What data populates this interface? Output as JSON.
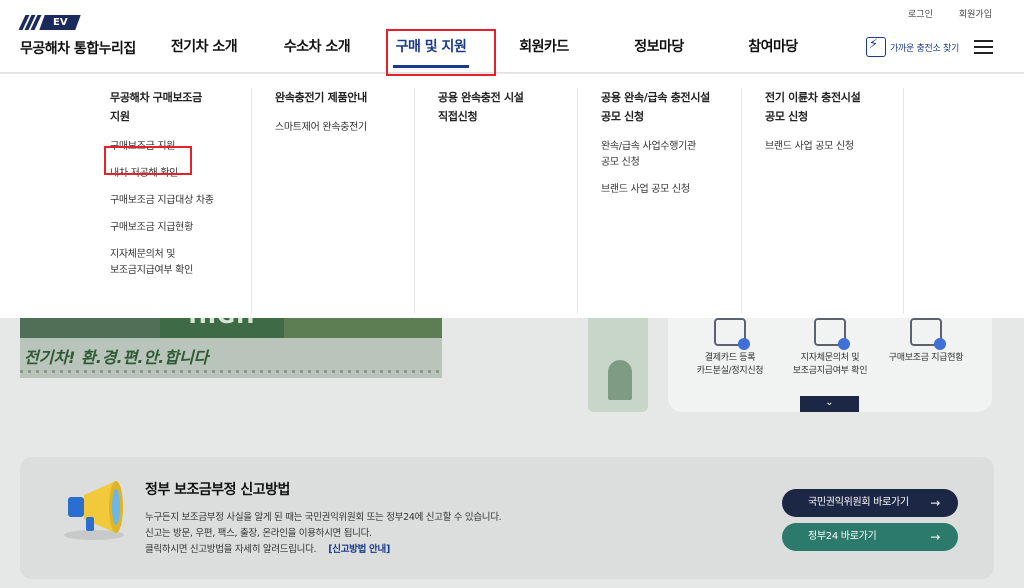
{
  "header": {
    "logo_badge": "EV",
    "logo_text": "무공해차 통합누리집",
    "util_links": [
      "로그인",
      "회원가입"
    ],
    "nav": [
      {
        "label": "전기차 소개"
      },
      {
        "label": "수소차 소개"
      },
      {
        "label": "구매 및 지원",
        "active": true
      },
      {
        "label": "회원카드"
      },
      {
        "label": "정보마당"
      },
      {
        "label": "참여마당"
      }
    ],
    "charger_find_label": "가까운 충전소 찾기",
    "charger_icon": "charger-icon",
    "menu_icon": "hamburger-icon"
  },
  "mega_menu": {
    "columns": [
      {
        "title": "무공해차 구매보조금\n지원",
        "items": [
          "구매보조금 지원",
          "내차 저공해 확인",
          "구매보조금 지급대상 차종",
          "구매보조금 지급현황",
          "지자체문의처 및\n보조금지급여부 확인"
        ]
      },
      {
        "title": "완속충전기 제품안내",
        "items": [
          "스마트제어 완속충전기"
        ]
      },
      {
        "title": "공용 완속충전 시설\n직접신청",
        "items": []
      },
      {
        "title": "공용 완속/급속 충전시설\n공모 신청",
        "items": [
          "완속/급속 사업수행기관\n공모 신청",
          "브랜드 사업 공모 신청"
        ]
      },
      {
        "title": "전기 이륜차 충전시설\n공모 신청",
        "items": [
          "브랜드 사업 공모 신청"
        ]
      }
    ]
  },
  "background": {
    "banner_word": "HIGH",
    "banner_slogan": "전기차! 환.경.편.안.합니다",
    "quick_links": [
      "결제카드 등록\n카드분실/정지신청",
      "지자체문의처 및\n보조금지급여부 확인",
      "구매보조금 지급현황"
    ],
    "quick_more_icon": "chevron-down-icon"
  },
  "report": {
    "icon": "megaphone-icon",
    "title": "정부 보조금부정 신고방법",
    "desc_lines": [
      "누구든지 보조금부정 사실을 알게 된 때는 국민권익위원회 또는 정부24에 신고할 수 있습니다.",
      "신고는 방문, 우편, 팩스, 출장, 온라인을 이용하시면 됩니다.",
      "클릭하시면 신고방법을 자세히 알려드립니다."
    ],
    "guide_link": "[신고방법 안내]",
    "buttons": [
      "국민권익위원회 바로가기",
      "정부24 바로가기"
    ],
    "button_arrow": "→"
  },
  "colors": {
    "primary_navy": "#1a3a8c",
    "highlight_red": "#e5212b",
    "teal_button": "#2b7a6c",
    "dark_button": "#1c2745"
  }
}
